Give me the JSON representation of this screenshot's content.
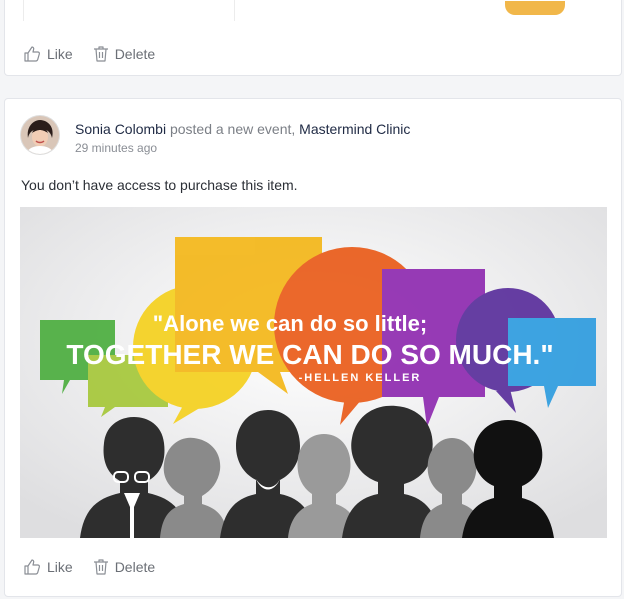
{
  "previous_post": {
    "like_label": "Like",
    "delete_label": "Delete"
  },
  "post": {
    "author_name": "Sonia Colombi",
    "action_text": "posted a new event,",
    "event_name": "Mastermind Clinic",
    "timestamp": "29 minutes ago",
    "message": "You don’t have access to purchase this item.",
    "image": {
      "quote_line1": "\"Alone we can do so little;",
      "quote_line2": "TOGETHER WE CAN DO SO MUCH.\"",
      "attribution": "-HELLEN KELLER"
    },
    "like_label": "Like",
    "delete_label": "Delete"
  },
  "colors": {
    "accent_orange": "#f1b74a",
    "link_dark": "#1f2a44",
    "muted": "#7b7f86"
  }
}
